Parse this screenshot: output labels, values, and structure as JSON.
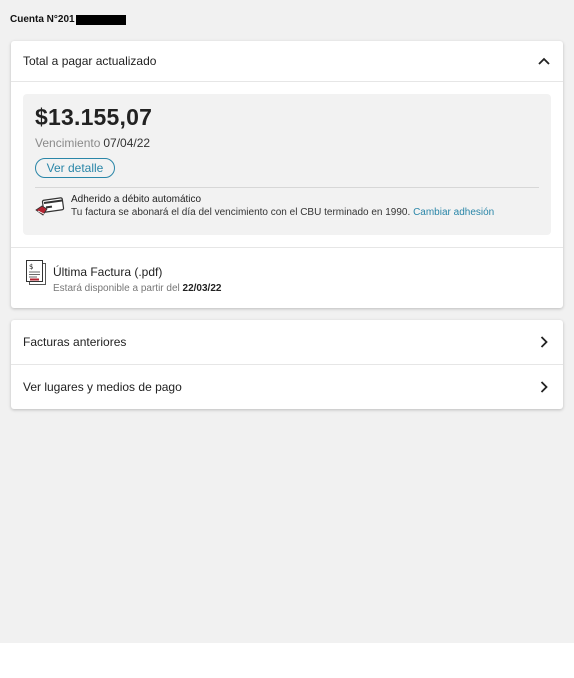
{
  "account": {
    "label": "Cuenta N°201"
  },
  "summary": {
    "header_title": "Total a pagar actualizado",
    "amount": "$13.155,07",
    "due_label": "Vencimiento",
    "due_date": "07/04/22",
    "detail_button": "Ver detalle",
    "auto_debit_title": "Adherido a débito automático",
    "auto_debit_text": "Tu factura se abonará el día del vencimiento con el CBU terminado en 1990.",
    "change_link": "Cambiar adhesión"
  },
  "last_invoice": {
    "title": "Última Factura (.pdf)",
    "available_text": "Estará disponible a partir del",
    "available_date": "22/03/22"
  },
  "links": [
    {
      "label": "Facturas anteriores"
    },
    {
      "label": "Ver lugares y medios de pago"
    }
  ],
  "colors": {
    "accent": "#2a86a8",
    "background": "#f1f1f1"
  },
  "icons": [
    "chevron-up-icon",
    "credit-card-icon",
    "invoice-document-icon",
    "chevron-right-icon"
  ]
}
